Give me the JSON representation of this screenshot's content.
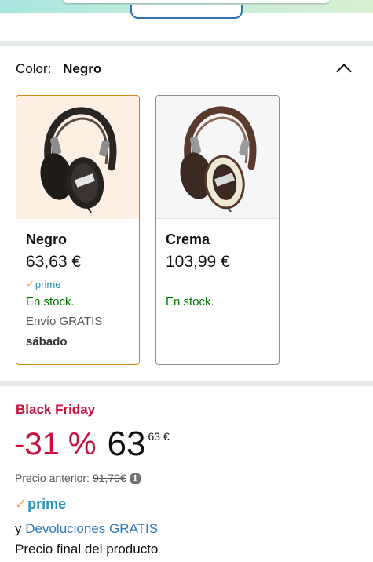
{
  "colors": {
    "accent_selected": "#c7890b",
    "deal_red": "#cc0c39",
    "stock_green": "#007600",
    "prime_blue": "#2791b8",
    "link_blue": "#2d79b8"
  },
  "color_selector": {
    "label": "Color:",
    "selected_value": "Negro",
    "collapse_icon": "chevron-up-icon"
  },
  "variants": [
    {
      "name": "Negro",
      "price": "63,63 €",
      "prime": "prime",
      "stock": "En stock.",
      "shipping": "Envío GRATIS",
      "delivery_day": "sábado",
      "selected": true,
      "image": "headphones-black"
    },
    {
      "name": "Crema",
      "price": "103,99 €",
      "stock": "En stock.",
      "selected": false,
      "image": "headphones-cream"
    }
  ],
  "pricing": {
    "deal_badge": "Black Friday",
    "discount": "-31 %",
    "price_whole": "63",
    "price_fraction": "63 €",
    "previous_label": "Precio anterior:",
    "previous_price": "91,70€",
    "info_icon": "info-icon",
    "prime": "prime",
    "returns_prefix": "y",
    "returns_link": "Devoluciones GRATIS",
    "final_price_note": "Precio final del producto"
  }
}
